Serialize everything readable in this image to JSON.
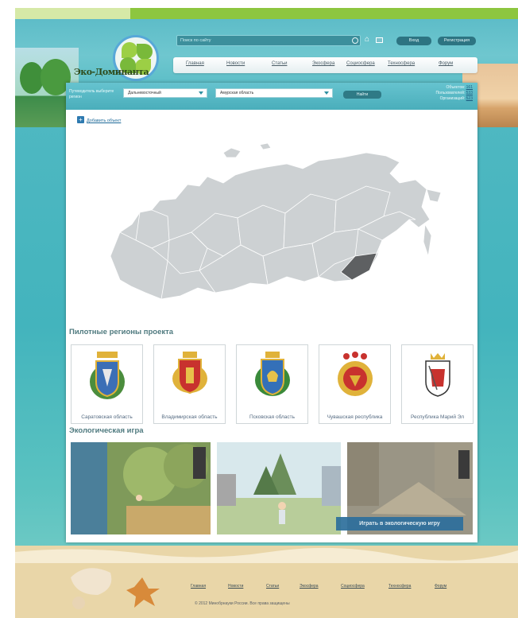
{
  "header": {
    "logo_text": "Эко-Доминанта",
    "search_placeholder": "Поиск по сайту",
    "login_label": "Вход",
    "register_label": "Регистрация"
  },
  "nav": {
    "items": [
      "Главная",
      "Новости",
      "Статьи",
      "Экосфера",
      "Социосфера",
      "Техносфера",
      "Форум"
    ]
  },
  "filter": {
    "label": "Путеводитель выберите регион",
    "district": "Дальневосточный",
    "region": "Амурская область",
    "find_label": "Найти",
    "stats": {
      "objects_label": "Объектов:",
      "objects_value": "161",
      "users_label": "Пользователей:",
      "users_value": "533",
      "orgs_label": "Организаций:",
      "orgs_value": "523"
    }
  },
  "main": {
    "add_object": "Добавить объект",
    "pilot_title": "Пилотные регионы проекта",
    "regions": [
      {
        "name": "Саратовская область"
      },
      {
        "name": "Владимирская область"
      },
      {
        "name": "Псковская область"
      },
      {
        "name": "Чувашская республика"
      },
      {
        "name": "Республика Марий Эл"
      }
    ],
    "game_title": "Экологическая игра",
    "play_label": "Играть в экологическую игру"
  },
  "footer": {
    "links": [
      "Главная",
      "Новости",
      "Статьи",
      "Экосфера",
      "Социосфера",
      "Техносфера",
      "Форум"
    ],
    "copyright": "© 2012 Минобрнауки России. Все права защищены"
  },
  "colors": {
    "accent": "#8dc63f",
    "teal": "#4aaebb",
    "highlight_region": "#5e6062"
  },
  "icons": [
    "search-icon",
    "home-icon",
    "mail-icon",
    "add-icon",
    "dropdown-arrow-icon"
  ]
}
